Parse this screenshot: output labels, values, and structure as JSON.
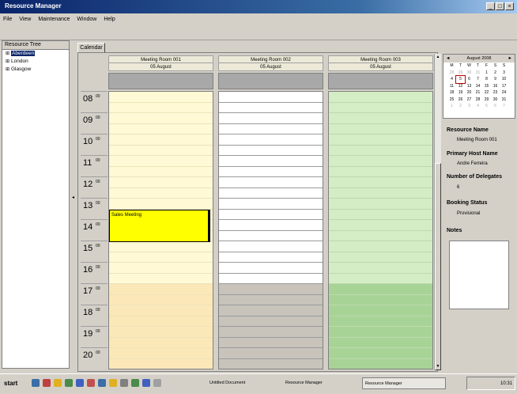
{
  "window": {
    "title": "Resource Manager",
    "buttons": [
      "_",
      "□",
      "×"
    ]
  },
  "menu": [
    "File",
    "View",
    "Maintenance",
    "Window",
    "Help"
  ],
  "tree": {
    "header": "Resource Tree",
    "items": [
      {
        "label": "Aberdeen",
        "selected": true
      },
      {
        "label": "London",
        "selected": false
      },
      {
        "label": "Glasgow",
        "selected": false
      }
    ]
  },
  "calendar": {
    "tab_label": "Calendar",
    "columns": [
      {
        "room": "Meeting Room 001",
        "date": "05 August"
      },
      {
        "room": "Meeting Room 002",
        "date": "05 August"
      },
      {
        "room": "Meeting Room 003",
        "date": "05 August"
      }
    ],
    "hours": [
      "08",
      "09",
      "10",
      "11",
      "12",
      "13",
      "14",
      "15",
      "16",
      "17",
      "18",
      "19",
      "20"
    ],
    "minutes_label": "00",
    "appointment": {
      "title": "Sales Meeting"
    }
  },
  "mini_calendar": {
    "month": "August 2008",
    "prev": "◄",
    "next": "►",
    "weekday_headers": [
      "M",
      "T",
      "W",
      "T",
      "F",
      "S",
      "S"
    ],
    "weeks": [
      [
        "28",
        "29",
        "30",
        "31",
        "1",
        "2",
        "3"
      ],
      [
        "4",
        "5",
        "6",
        "7",
        "8",
        "9",
        "10"
      ],
      [
        "11",
        "12",
        "13",
        "14",
        "15",
        "16",
        "17"
      ],
      [
        "18",
        "19",
        "20",
        "21",
        "22",
        "23",
        "24"
      ],
      [
        "25",
        "26",
        "27",
        "28",
        "29",
        "30",
        "31"
      ],
      [
        "1",
        "2",
        "3",
        "4",
        "5",
        "6",
        "7"
      ]
    ],
    "today": "5"
  },
  "details": {
    "resource_name_label": "Resource Name",
    "resource_name": "Meeting Room 001",
    "primary_host_label": "Primary Host Name",
    "primary_host": "Andre Ferreira",
    "delegates_label": "Number of Delegates",
    "delegates": "6",
    "status_label": "Booking Status",
    "status": "Provisional",
    "notes_label": "Notes"
  },
  "taskbar": {
    "start": "start",
    "tasks": [
      "Untitled Document",
      "Resource Manager",
      "Resource Manager"
    ],
    "clock": "10:31"
  },
  "colors": {
    "selection": "#0a246a",
    "appointment": "#ffff00",
    "col1_day": "#fff9d6",
    "col1_after": "#fbe8b8",
    "col3_day": "#d4edc4",
    "col3_after": "#a8d396",
    "col2_after": "#c8c4bc"
  }
}
